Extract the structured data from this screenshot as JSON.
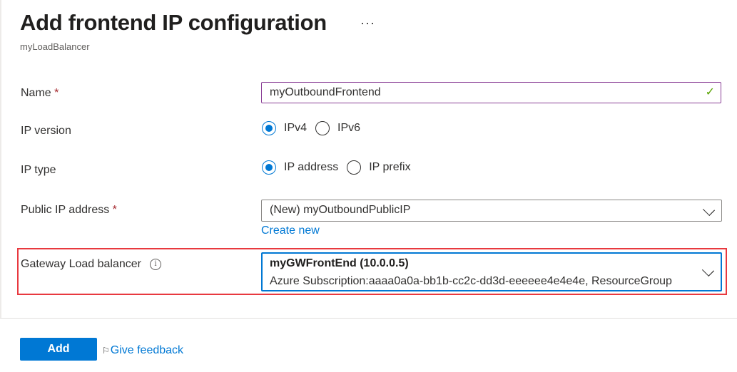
{
  "header": {
    "title": "Add frontend IP configuration",
    "more_label": "···",
    "subtitle": "myLoadBalancer"
  },
  "form": {
    "name": {
      "label": "Name",
      "required_mark": "*",
      "value": "myOutboundFrontend",
      "valid_icon": "✓"
    },
    "ip_version": {
      "label": "IP version",
      "options": [
        {
          "label": "IPv4",
          "selected": true
        },
        {
          "label": "IPv6",
          "selected": false
        }
      ]
    },
    "ip_type": {
      "label": "IP type",
      "options": [
        {
          "label": "IP address",
          "selected": true
        },
        {
          "label": "IP prefix",
          "selected": false
        }
      ]
    },
    "public_ip": {
      "label": "Public IP address",
      "required_mark": "*",
      "value": "(New) myOutboundPublicIP",
      "create_new_label": "Create new"
    },
    "gateway_lb": {
      "label": "Gateway Load balancer",
      "info_icon": "i",
      "value_title": "myGWFrontEnd (10.0.0.5)",
      "value_detail": "Azure Subscription:aaaa0a0a-bb1b-cc2c-dd3d-eeeeee4e4e4e, ResourceGroup"
    }
  },
  "footer": {
    "add_label": "Add",
    "feedback_label": "Give feedback",
    "feedback_icon": "⚐"
  },
  "colors": {
    "accent": "#0078d4",
    "highlight": "#e8393f",
    "required": "#a4262c",
    "valid": "#57a300"
  }
}
